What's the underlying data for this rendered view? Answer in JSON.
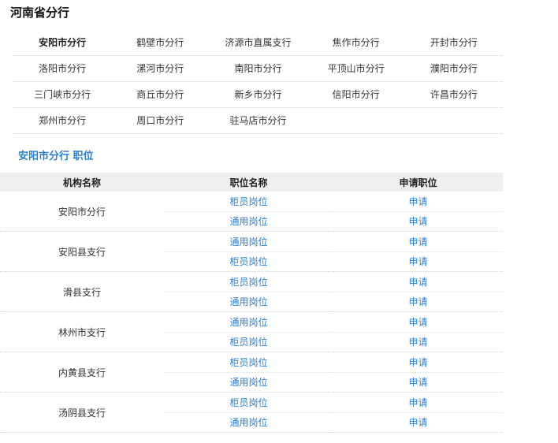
{
  "province": {
    "title": "河南省分行"
  },
  "branches": [
    [
      "安阳市分行",
      "鹤壁市分行",
      "济源市直属支行",
      "焦作市分行",
      "开封市分行"
    ],
    [
      "洛阳市分行",
      "漯河市分行",
      "南阳市分行",
      "平顶山市分行",
      "濮阳市分行"
    ],
    [
      "三门峡市分行",
      "商丘市分行",
      "新乡市分行",
      "信阳市分行",
      "许昌市分行"
    ],
    [
      "郑州市分行",
      "周口市分行",
      "驻马店市分行"
    ]
  ],
  "active_branch": "安阳市分行",
  "section": {
    "title": "安阳市分行 职位"
  },
  "table": {
    "headers": {
      "org": "机构名称",
      "position": "职位名称",
      "apply": "申请职位"
    },
    "apply_label": "申请",
    "rows": [
      {
        "org": "安阳市分行",
        "positions": [
          "柜员岗位",
          "通用岗位"
        ]
      },
      {
        "org": "安阳县支行",
        "positions": [
          "通用岗位",
          "柜员岗位"
        ]
      },
      {
        "org": "滑县支行",
        "positions": [
          "柜员岗位",
          "通用岗位"
        ]
      },
      {
        "org": "林州市支行",
        "positions": [
          "通用岗位",
          "柜员岗位"
        ]
      },
      {
        "org": "内黄县支行",
        "positions": [
          "柜员岗位",
          "通用岗位"
        ]
      },
      {
        "org": "汤阴县支行",
        "positions": [
          "柜员岗位",
          "通用岗位"
        ]
      }
    ]
  },
  "colors": {
    "link": "#2a7fd0",
    "header_bg": "#efefef",
    "divider": "#cfcfcf"
  }
}
